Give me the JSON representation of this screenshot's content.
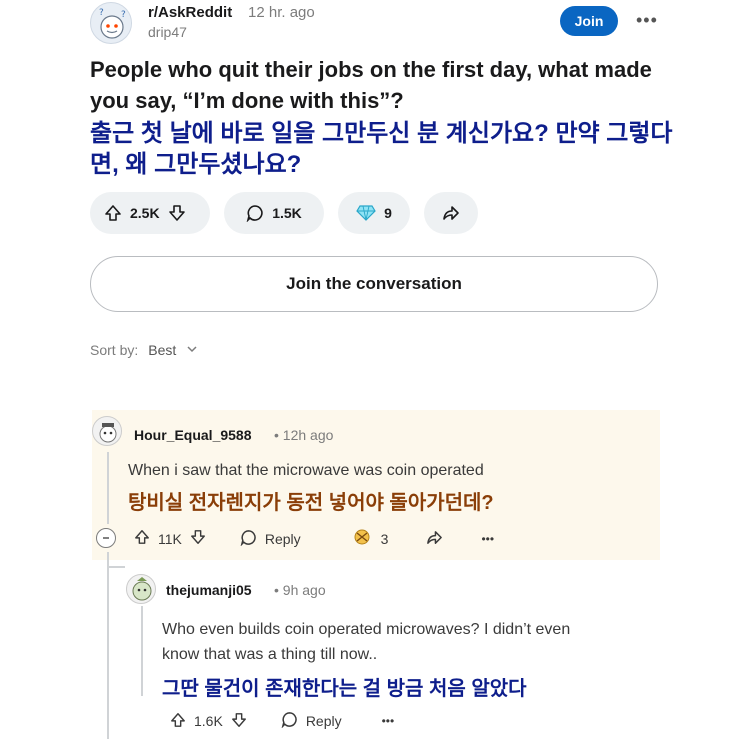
{
  "post": {
    "subreddit": "r/AskReddit",
    "time": "12 hr. ago",
    "author": "drip47",
    "join_label": "Join",
    "more_label": "•••",
    "title_en": "People who quit their jobs on the first day, what made you say, “I’m done with this”?",
    "title_ko": "출근 첫 날에 바로 일을 그만두신 분 계신가요? 만약 그렇다면, 왜 그만두셨나요?",
    "upvotes": "2.5K",
    "comments": "1.5K",
    "awards": "9",
    "conversation_label": "Join the conversation"
  },
  "sort": {
    "label": "Sort by:",
    "value": "Best"
  },
  "comments": [
    {
      "author": "Hour_Equal_9588",
      "time": "• 12h ago",
      "text_en": "When i saw that the microwave was coin operated",
      "text_ko": "탕비실 전자렌지가 동전 넣어야 돌아가던데?",
      "votes": "11K",
      "reply_label": "Reply",
      "awards": "3",
      "more": "•••"
    },
    {
      "author": "thejumanji05",
      "time": "• 9h ago",
      "text_en_1": "Who even builds coin operated microwaves? I didn’t even",
      "text_en_2": "know that was a thing till now..",
      "text_ko": "그딴 물건이 존재한다는 걸 방금 처음 알았다",
      "votes": "1.6K",
      "reply_label": "Reply",
      "more": "•••"
    }
  ],
  "colors": {
    "accent": "#0a66c2",
    "korean_title": "#0e1e8c",
    "korean_comment": "#8a3e08",
    "highlight_bg": "#fdf8ec"
  }
}
